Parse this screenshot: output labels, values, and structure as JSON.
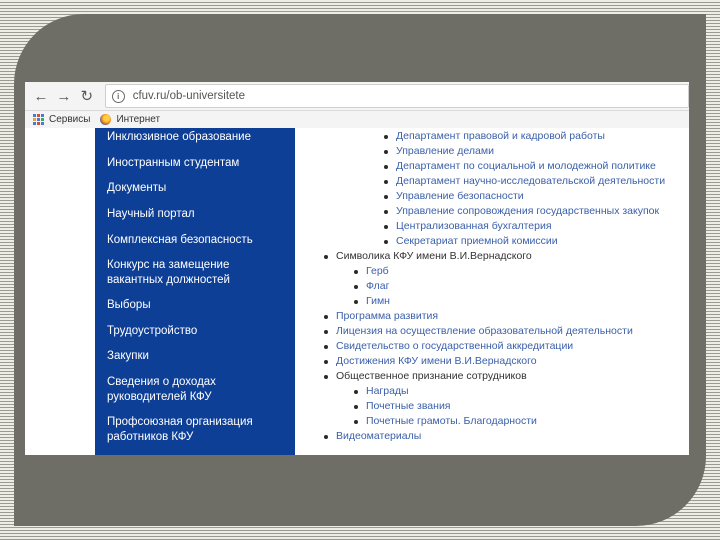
{
  "browser": {
    "url": "cfuv.ru/ob-universitete",
    "bookmarks": [
      "Сервисы",
      "Интернет"
    ]
  },
  "sidebar": {
    "items": [
      {
        "label": "Инклюзивное образование"
      },
      {
        "label": "Иностранным студентам"
      },
      {
        "label": "Документы"
      },
      {
        "label": "Научный портал"
      },
      {
        "label": "Комплексная безопасность"
      },
      {
        "label": "Конкурс на замещение вакантных должностей"
      },
      {
        "label": "Выборы"
      },
      {
        "label": "Трудоустройство"
      },
      {
        "label": "Закупки"
      },
      {
        "label": "Сведения о доходах руководителей КФУ"
      },
      {
        "label": "Профсоюзная организация работников КФУ"
      }
    ]
  },
  "content": {
    "items": [
      {
        "label": "Департамент правовой и кадровой работы"
      },
      {
        "label": "Управление делами"
      },
      {
        "label": "Департамент по социальной и молодежной политике"
      },
      {
        "label": "Департамент научно-исследовательской деятельности"
      },
      {
        "label": "Управление безопасности"
      },
      {
        "label": "Управление сопровождения государственных закупок"
      },
      {
        "label": "Централизованная бухгалтерия"
      },
      {
        "label": "Секретариат приемной комиссии"
      },
      {
        "label": "Символика КФУ имени В.И.Вернадского"
      },
      {
        "label": "Герб"
      },
      {
        "label": "Флаг"
      },
      {
        "label": "Гимн"
      },
      {
        "label": "Программа развития"
      },
      {
        "label": "Лицензия на осуществление образовательной деятельности"
      },
      {
        "label": "Свидетельство о государственной аккредитации"
      },
      {
        "label": "Достижения КФУ имени В.И.Вернадского"
      },
      {
        "label": "Общественное признание сотрудников"
      },
      {
        "label": "Награды"
      },
      {
        "label": "Почетные звания"
      },
      {
        "label": "Почетные грамоты. Благодарности"
      },
      {
        "label": "Видеоматериалы"
      }
    ]
  }
}
